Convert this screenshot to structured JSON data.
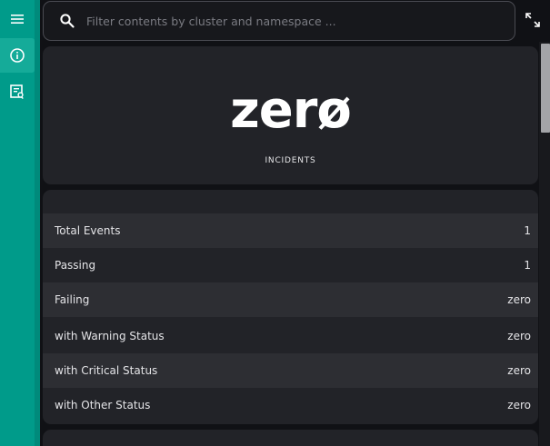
{
  "search": {
    "placeholder": "Filter contents by cluster and namespace ..."
  },
  "hero": {
    "value": "zerø",
    "caption": "INCIDENTS"
  },
  "stats": [
    {
      "label": "Total Events",
      "value": "1"
    },
    {
      "label": "Passing",
      "value": "1"
    },
    {
      "label": "Failing",
      "value": "zero"
    },
    {
      "label": "with Warning Status",
      "value": "zero"
    },
    {
      "label": "with Critical Status",
      "value": "zero"
    },
    {
      "label": "with Other Status",
      "value": "zero"
    }
  ],
  "icons": {
    "menu": "hamburger-menu-icon",
    "info": "info-icon",
    "report": "report-icon",
    "search": "search-icon",
    "expand": "expand-icon"
  },
  "colors": {
    "rail": "#009b8a",
    "card": "#222328",
    "background": "#101115"
  }
}
